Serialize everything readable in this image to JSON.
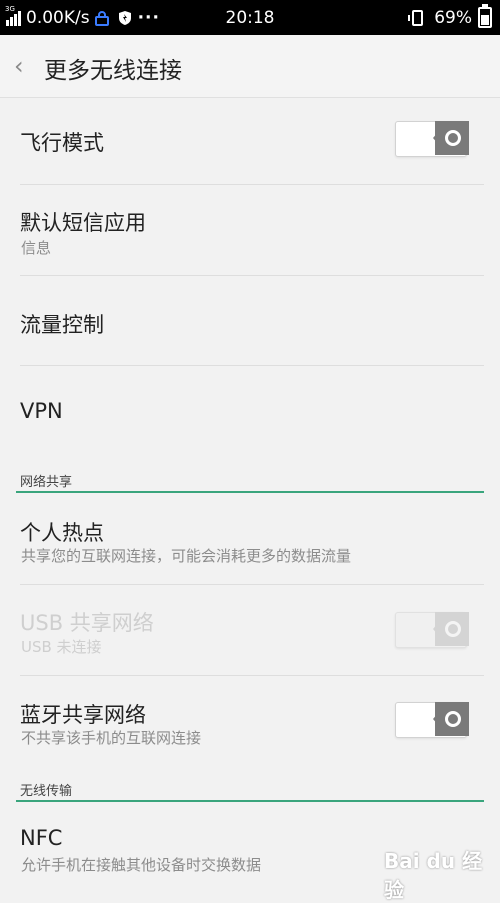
{
  "status_bar": {
    "network_type": "3G",
    "speed": "0.00K/s",
    "time": "20:18",
    "battery": "69%",
    "more": "···"
  },
  "header": {
    "title": "更多无线连接"
  },
  "items": [
    {
      "label": "飞行模式",
      "subtitle": "",
      "toggle": "off",
      "enabled": true
    },
    {
      "label": "默认短信应用",
      "subtitle": "信息"
    },
    {
      "label": "流量控制",
      "subtitle": ""
    },
    {
      "label": "VPN",
      "subtitle": ""
    }
  ],
  "section_network_sharing": {
    "title": "网络共享",
    "items": [
      {
        "label": "个人热点",
        "subtitle": "共享您的互联网连接，可能会消耗更多的数据流量"
      },
      {
        "label": "USB 共享网络",
        "subtitle": "USB 未连接",
        "toggle": "off",
        "enabled": false
      },
      {
        "label": "蓝牙共享网络",
        "subtitle": "不共享该手机的互联网连接",
        "toggle": "off",
        "enabled": true
      }
    ]
  },
  "section_wireless_transfer": {
    "title": "无线传输",
    "items": [
      {
        "label": "NFC",
        "subtitle": "允许手机在接触其他设备时交换数据"
      }
    ]
  },
  "watermark": "Bai du 经验",
  "colors": {
    "accent": "#3aa57d",
    "background": "#f2f2f2",
    "status_bar": "#000000"
  }
}
